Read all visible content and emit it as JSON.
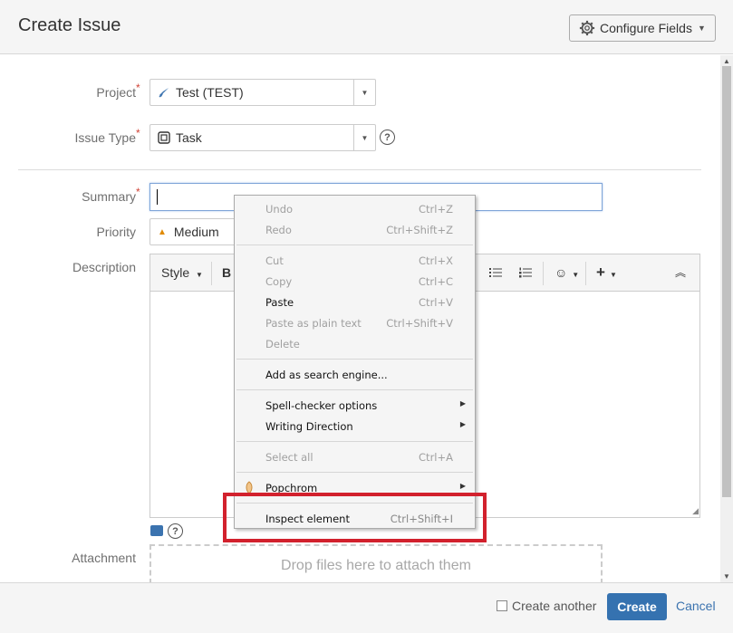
{
  "dialog": {
    "title": "Create Issue",
    "configure_fields": "Configure Fields"
  },
  "fields": {
    "project": {
      "label": "Project",
      "value": "Test (TEST)"
    },
    "issue_type": {
      "label": "Issue Type",
      "value": "Task"
    },
    "summary": {
      "label": "Summary",
      "value": ""
    },
    "priority": {
      "label": "Priority",
      "value": "Medium"
    },
    "description": {
      "label": "Description"
    },
    "attachment": {
      "label": "Attachment",
      "drop_text": "Drop files here to attach them"
    }
  },
  "required_mark": "*",
  "toolbar": {
    "style_label": "Style",
    "bold_label": "B"
  },
  "context_menu": {
    "undo": {
      "label": "Undo",
      "shortcut": "Ctrl+Z"
    },
    "redo": {
      "label": "Redo",
      "shortcut": "Ctrl+Shift+Z"
    },
    "cut": {
      "label": "Cut",
      "shortcut": "Ctrl+X"
    },
    "copy": {
      "label": "Copy",
      "shortcut": "Ctrl+C"
    },
    "paste": {
      "label": "Paste",
      "shortcut": "Ctrl+V"
    },
    "paste_plain": {
      "label": "Paste as plain text",
      "shortcut": "Ctrl+Shift+V"
    },
    "delete": {
      "label": "Delete"
    },
    "add_search_engine": {
      "label": "Add as search engine..."
    },
    "spell_checker": {
      "label": "Spell-checker options"
    },
    "writing_direction": {
      "label": "Writing Direction"
    },
    "select_all": {
      "label": "Select all",
      "shortcut": "Ctrl+A"
    },
    "popchrom": {
      "label": "Popchrom"
    },
    "inspect": {
      "label": "Inspect element",
      "shortcut": "Ctrl+Shift+I"
    }
  },
  "footer": {
    "create_another": "Create another",
    "create": "Create",
    "cancel": "Cancel"
  },
  "colors": {
    "primary_button": "#3572b0",
    "required": "#d04437",
    "highlight_box": "#d2212d",
    "link": "#3b73af"
  }
}
